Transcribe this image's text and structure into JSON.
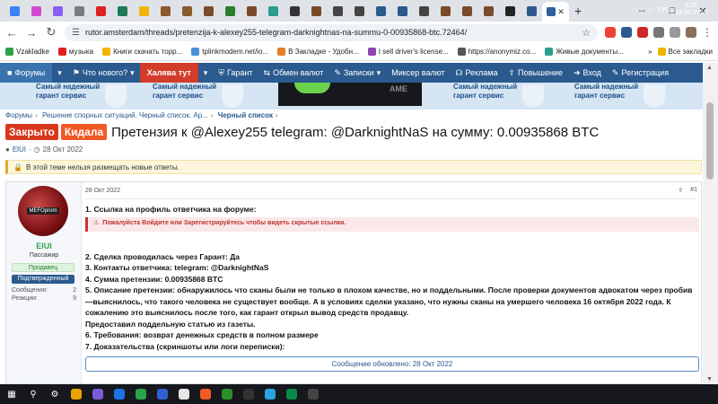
{
  "browser": {
    "tab_favicon_colors": [
      "#3b82f6",
      "#d04bd0",
      "#8a5cf6",
      "#7b7b7b",
      "#e02020",
      "#1f7a5a",
      "#f0b400",
      "#8a5a2b",
      "#8a5a2b",
      "#7a4a2a",
      "#2a7d2a",
      "#7a4a2a",
      "#2a9d8f",
      "#333",
      "#7a4a2a",
      "#444",
      "#444",
      "#2a5a8e",
      "#2a5a8e",
      "#444",
      "#7a4a2a",
      "#7a4a2a",
      "#7a4a2a",
      "#222",
      "#2a5a8e"
    ],
    "new_tab_icon": "plus-icon",
    "window_controls": [
      "minimize-icon",
      "maximize-icon",
      "close-icon"
    ],
    "url": "rutor.amsterdam/threads/pretenzija-k-alexey255-telegram-darknightnas-na-summu-0-00935868-btc.72464/",
    "bookmarks": [
      "Vzakladke",
      "музыка",
      "Книги скачать торр...",
      "tplinkmodem.net/io...",
      "В Закладке - Удобн...",
      "I sell driver's license...",
      "https://anonymiz.co...",
      "Живые документы..."
    ],
    "all_bookmarks_label": "Все закладки"
  },
  "site_nav": {
    "forums": "Форумы",
    "whats_new": "Что нового?",
    "hot": "Халява тут",
    "garant": "Гарант",
    "exchange": "Обмен валют",
    "notes": "Записки",
    "mixer": "Миксер валют",
    "ads": "Реклама",
    "promo": "Повышение",
    "login": "Вход",
    "register": "Регистрация"
  },
  "banner": {
    "line1": "Самый надежный",
    "line2": "гарант сервис"
  },
  "breadcrumb": {
    "item1": "Форумы",
    "item2": "Решение спорных ситуаций. Черный список. Ар...",
    "item3": "Черный список"
  },
  "thread": {
    "label_closed": "Закрыто",
    "label_kid": "Кидала",
    "title": "Претензия к @Alexey255 telegram: @DarknightNaS на сумму: 0.00935868 BTC",
    "author": "ElUI",
    "date": "28 Окт 2022",
    "notice": "В этой теме нельзя размещать новые ответы."
  },
  "post": {
    "avatar_text": "MEFOprom",
    "username": "ElUI",
    "user_title": "Пассажир",
    "badge_seller": "Продавец",
    "badge_verified": "Подтвержденный",
    "messages_label": "Сообщения:",
    "messages_value": "2",
    "reactions_label": "Реакции:",
    "reactions_value": "9",
    "date": "28 Окт 2022",
    "number": "#1",
    "line1": "1. Ссылка на профиль ответчика на форуме:",
    "hidden_links": "Пожалуйста Войдите или Зарегистрируйтесь чтобы видеть скрытые ссылки.",
    "line2": "2. Сделка проводилась через Гарант: Да",
    "line3": "3. Контакты ответчика: telegram: @DarknightNaS",
    "line4": "4. Сумма претензии: 0.00935868 BTC",
    "line5": "5. Описание претензии: обнаружилось что сканы были не только в плохом качестве, но и поддельными. После проверки документов адвокатом через пробив—выяснилось, что такого человека не существует вообще. А в условиях сделки указано, что нужны сканы на умершего человека 16 октября 2022 года. К сожалению это выяснилось после того, как гарант открыл вывод средств продавцу.",
    "line6": "Предоставил поддельную статью из газеты.",
    "line7": "6. Требования: возврат денежных средств в полном размере",
    "line8": "7. Доказательства (скриншоты или логи переписки):",
    "updated": "Сообщение обновлено: 28 Окт 2022"
  },
  "taskbar": {
    "lang": "РУС",
    "time": "5:09",
    "date": "16.06.2024",
    "app_colors": [
      "#e9a400",
      "#7b5cd6",
      "#1a73e8",
      "#2aa34a",
      "#2f5fd0",
      "#e6e6e6",
      "#f15a24",
      "#2a8f2a",
      "#333",
      "#2aa4e0",
      "#0a8a4a",
      "#444"
    ]
  }
}
